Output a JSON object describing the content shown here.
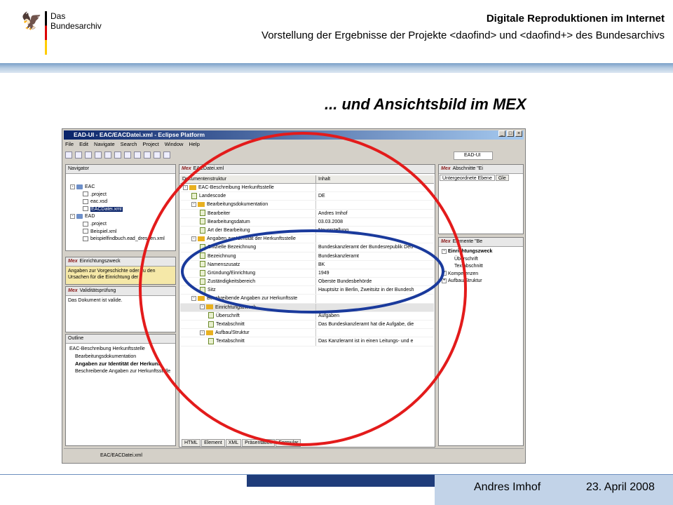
{
  "header": {
    "logo_line1": "Das",
    "logo_line2": "Bundesarchiv",
    "title": "Digitale Reproduktionen im Internet",
    "subtitle": "Vorstellung der Ergebnisse der Projekte <daofind> und <daofind+> des Bundesarchivs"
  },
  "slide_title": "... und Ansichtsbild im MEX",
  "eclipse": {
    "window_title": "EAD-UI - EAC/EACDatei.xml - Eclipse Platform",
    "menu": [
      "File",
      "Edit",
      "Navigate",
      "Search",
      "Project",
      "Window",
      "Help"
    ],
    "perspective": "EAD-UI",
    "navigator": {
      "title": "Navigator",
      "items": [
        "EAC",
        ".project",
        "eac.xsd",
        "EACDatei.xml",
        "EAD",
        ".project",
        "Beispiel.xml",
        "beispielfindbuch.ead_dresden.xml"
      ]
    },
    "einrichtungszweck": {
      "title": "Einrichtungszweck",
      "text": "Angaben zur Vorgeschichte oder zu den Ursachen für die Einrichtung der"
    },
    "validitaet": {
      "title": "Validitätsprüfung",
      "text": "Das Dokument ist valide."
    },
    "outline": {
      "title": "Outline",
      "items": [
        "EAC-Beschreibung Herkunftsstelle",
        "Bearbeitungsdokumentation",
        "Angaben zur Identität der Herkunf",
        "Beschreibende Angaben zur Herkunftsstelle"
      ]
    },
    "editor": {
      "tab": "EACDatei.xml",
      "col1": "Dokumentenstruktur",
      "col2": "Inhalt",
      "rows": [
        {
          "l": "EAC-Beschreibung Herkunftsstelle",
          "v": ""
        },
        {
          "l": "Landescode",
          "v": "DE"
        },
        {
          "l": "Bearbeitungsdokumentation",
          "v": ""
        },
        {
          "l": "Bearbeiter",
          "v": "Andres Imhof"
        },
        {
          "l": "Bearbeitungsdatum",
          "v": "03.03.2008"
        },
        {
          "l": "Art der Bearbeitung",
          "v": "Neuerstellung"
        },
        {
          "l": "Angaben zur Identität der Herkunftsstelle",
          "v": ""
        },
        {
          "l": "Offizielle Bezeichnung",
          "v": "Bundeskanzleramt der Bundesrepublik Deu"
        },
        {
          "l": "Bezeichnung",
          "v": "Bundeskanzleramt"
        },
        {
          "l": "Namenszusatz",
          "v": "BK"
        },
        {
          "l": "Gründung/Einrichtung",
          "v": "1949"
        },
        {
          "l": "Zuständigkeitsbereich",
          "v": "Oberste Bundesbehörde"
        },
        {
          "l": "Sitz",
          "v": "Hauptsitz in Berlin, Zweitsitz in der Bundesh"
        },
        {
          "l": "Beschreibende Angaben zur Herkunftsste",
          "v": ""
        },
        {
          "l": "Einrichtungszweck",
          "v": ""
        },
        {
          "l": "Überschrift",
          "v": "Aufgaben"
        },
        {
          "l": "Textabschnitt",
          "v": "Das Bundeskanzleramt hat die Aufgabe, die"
        },
        {
          "l": "Aufbau/Struktur",
          "v": ""
        },
        {
          "l": "Textabschnitt",
          "v": "Das Kanzleramt ist in einen Leitungs- und e"
        }
      ],
      "bottom_tabs": [
        "HTML",
        "Element",
        "XML",
        "Präsentation",
        "Formular"
      ]
    },
    "abschnitte": {
      "title": "Abschnitte \"Ei",
      "tab1": "Untergeordnete Ebene",
      "tab2": "Gle"
    },
    "elemente": {
      "title": "Elemente \"Be",
      "items": [
        "Einrichtungszweck",
        "Überschrift",
        "Textabschnitt",
        "Kompetenzen",
        "Aufbau/Struktur"
      ]
    },
    "status": "EAC/EACDatei.xml"
  },
  "footer": {
    "author": "Andres Imhof",
    "date": "23. April 2008"
  },
  "colors": {
    "band": "#7aa0c8",
    "footer_dark": "#1f3c7a",
    "footer_light": "#c2d3e8",
    "ellipse_red": "#e31b1b",
    "ellipse_blue": "#1a3a9c"
  }
}
